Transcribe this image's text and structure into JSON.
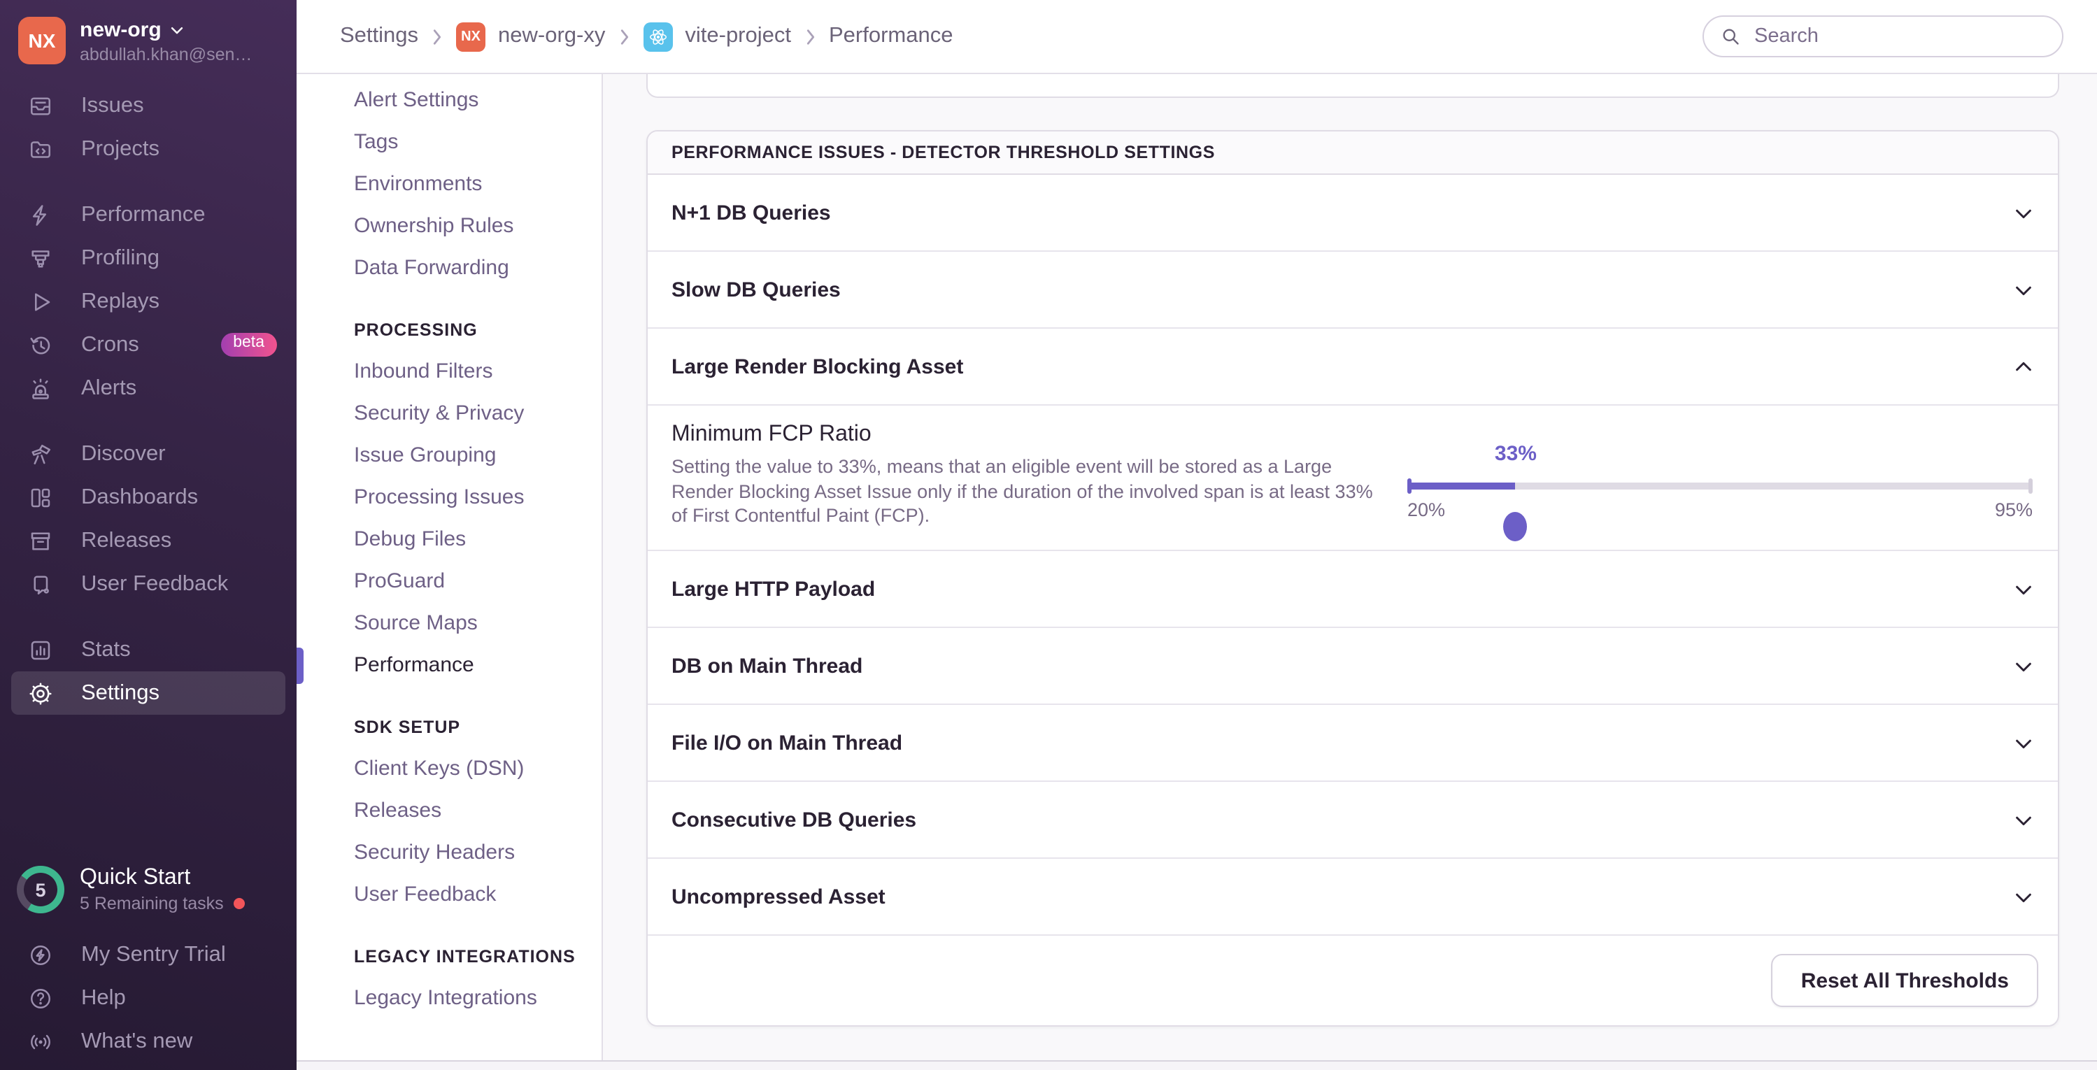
{
  "org": {
    "initials": "NX",
    "name": "new-org",
    "email": "abdullah.khan@sen…"
  },
  "primary_nav": {
    "items": [
      {
        "label": "Issues"
      },
      {
        "label": "Projects"
      },
      {
        "label": "Performance"
      },
      {
        "label": "Profiling"
      },
      {
        "label": "Replays"
      },
      {
        "label": "Crons",
        "badge": "beta"
      },
      {
        "label": "Alerts"
      },
      {
        "label": "Discover"
      },
      {
        "label": "Dashboards"
      },
      {
        "label": "Releases"
      },
      {
        "label": "User Feedback"
      },
      {
        "label": "Stats"
      },
      {
        "label": "Settings",
        "active": true
      }
    ]
  },
  "quick_start": {
    "title": "Quick Start",
    "subtitle": "5 Remaining tasks",
    "progress": "5"
  },
  "sidebar_footer": {
    "items": [
      {
        "label": "My Sentry Trial"
      },
      {
        "label": "Help"
      },
      {
        "label": "What's new"
      }
    ]
  },
  "breadcrumbs": {
    "crumbs": [
      {
        "label": "Settings"
      },
      {
        "label": "new-org-xy",
        "badge": "NX"
      },
      {
        "label": "vite-project",
        "icon": "react"
      },
      {
        "label": "Performance"
      }
    ]
  },
  "search": {
    "placeholder": "Search"
  },
  "subnav": {
    "sections": [
      {
        "header": "",
        "items": [
          "Alert Settings",
          "Tags",
          "Environments",
          "Ownership Rules",
          "Data Forwarding"
        ]
      },
      {
        "header": "PROCESSING",
        "items": [
          "Inbound Filters",
          "Security & Privacy",
          "Issue Grouping",
          "Processing Issues",
          "Debug Files",
          "ProGuard",
          "Source Maps",
          "Performance"
        ]
      },
      {
        "header": "SDK SETUP",
        "items": [
          "Client Keys (DSN)",
          "Releases",
          "Security Headers",
          "User Feedback"
        ]
      },
      {
        "header": "LEGACY INTEGRATIONS",
        "items": [
          "Legacy Integrations"
        ]
      }
    ],
    "active_item": "Performance"
  },
  "panel": {
    "title": "PERFORMANCE ISSUES - DETECTOR THRESHOLD SETTINGS",
    "rows": [
      {
        "label": "N+1 DB Queries",
        "state": "collapsed"
      },
      {
        "label": "Slow DB Queries",
        "state": "collapsed"
      },
      {
        "label": "Large Render Blocking Asset",
        "state": "expanded"
      },
      {
        "label": "Large HTTP Payload",
        "state": "collapsed"
      },
      {
        "label": "DB on Main Thread",
        "state": "collapsed"
      },
      {
        "label": "File I/O on Main Thread",
        "state": "collapsed"
      },
      {
        "label": "Consecutive DB Queries",
        "state": "collapsed"
      },
      {
        "label": "Uncompressed Asset",
        "state": "collapsed"
      }
    ],
    "expanded": {
      "label": "Minimum FCP Ratio",
      "description": "Setting the value to 33%, means that an eligible event will be stored as a Large Render Blocking Asset Issue only if the duration of the involved span is at least 33% of First Contentful Paint (FCP).",
      "slider": {
        "value": 33,
        "min": 20,
        "max": 95,
        "value_label": "33%",
        "min_label": "20%",
        "max_label": "95%"
      }
    },
    "footer_button": "Reset All Thresholds"
  },
  "colors": {
    "accent": "#6c5fc7",
    "org_avatar": "#e8684c",
    "project_badge": "#59c2ec",
    "progress_ring": "#3eb78f",
    "alert_dot": "#f2555a",
    "beta_gradient": "#a23fb0 → #f1538e"
  }
}
